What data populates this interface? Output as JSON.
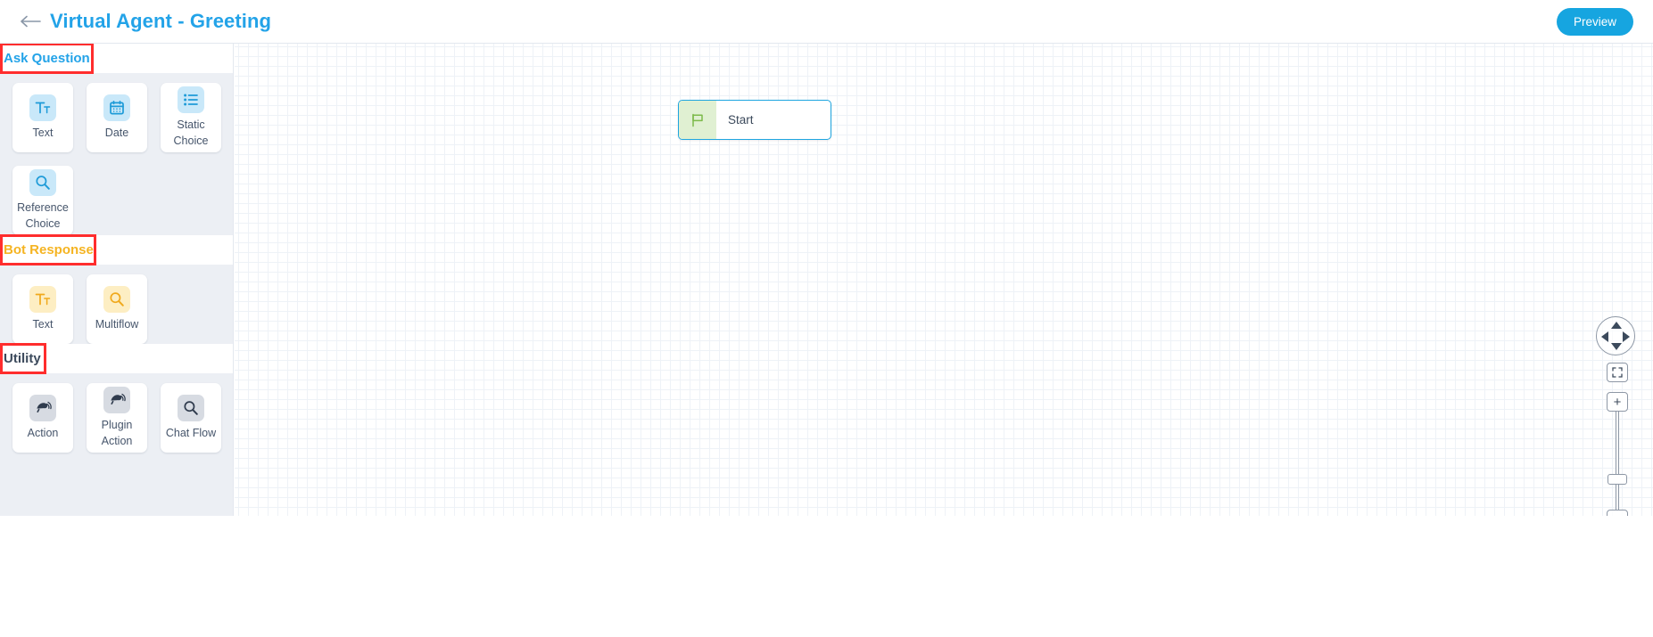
{
  "header": {
    "back_icon": "back-arrow-icon",
    "title": "Virtual Agent - Greeting",
    "preview_label": "Preview",
    "title_color": "#23a3e8",
    "preview_bg": "#16a5e0"
  },
  "sidebar": {
    "sections": [
      {
        "label": "Ask Question",
        "color": "#23a3e8",
        "highlight_color": "#ff2d2d",
        "highlight_width": 105,
        "chip": "blue",
        "cards": [
          {
            "label": "Text",
            "icon": "text-format-icon"
          },
          {
            "label": "Date",
            "icon": "calendar-icon"
          },
          {
            "label": "Static Choice",
            "icon": "list-icon"
          },
          {
            "label": "Reference Choice",
            "icon": "magnifier-icon"
          }
        ]
      },
      {
        "label": "Bot Response",
        "color": "#f5b422",
        "highlight_color": "#ff2d2d",
        "highlight_width": 108,
        "chip": "amber",
        "cards": [
          {
            "label": "Text",
            "icon": "text-format-icon"
          },
          {
            "label": "Multiflow",
            "icon": "magnifier-icon"
          }
        ]
      },
      {
        "label": "Utility",
        "color": "#3c4a5c",
        "highlight_color": "#ff2d2d",
        "highlight_width": 52,
        "chip": "gray",
        "cards": [
          {
            "label": "Action",
            "icon": "action-icon"
          },
          {
            "label": "Plugin Action",
            "icon": "action-icon"
          },
          {
            "label": "Chat Flow",
            "icon": "magnifier-icon"
          }
        ]
      }
    ]
  },
  "canvas": {
    "nodes": [
      {
        "label": "Start",
        "icon": "flag-icon",
        "border_color": "#1ea5e0",
        "icon_bg": "#e0f0d2"
      }
    ],
    "controls": {
      "pan_icon": "directional-pad-icon",
      "fit_icon": "fit-to-screen-icon",
      "zoom_in_label": "+",
      "zoom_out_label": "−"
    }
  }
}
